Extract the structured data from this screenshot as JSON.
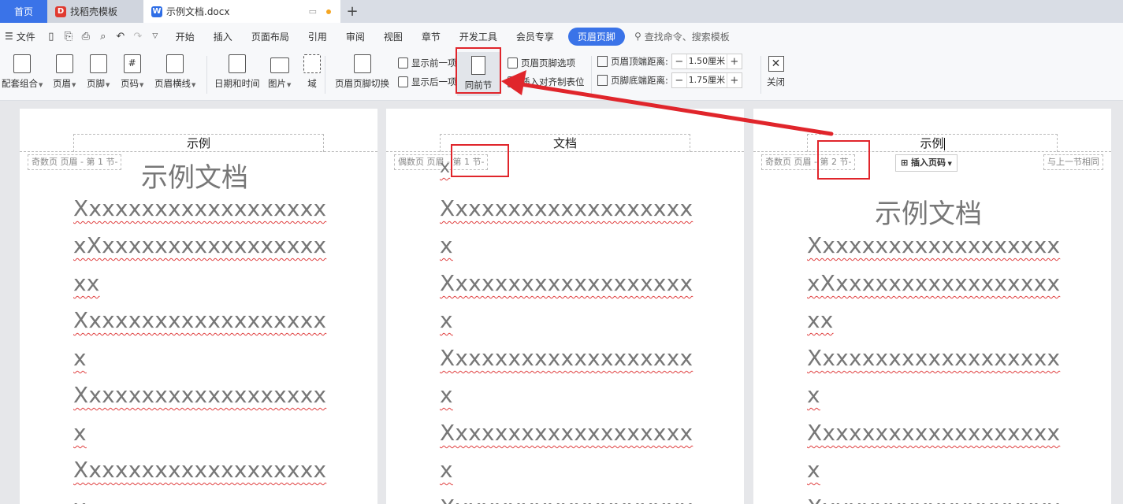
{
  "tabs": {
    "home": "首页",
    "templates": "找稻壳模板",
    "doc": "示例文档.docx"
  },
  "menu": {
    "file": "文件",
    "items": [
      "开始",
      "插入",
      "页面布局",
      "引用",
      "审阅",
      "视图",
      "章节",
      "开发工具",
      "会员专享"
    ],
    "active": "页眉页脚",
    "search": "查找命令、搜索模板"
  },
  "ribbon": {
    "combo": "配套组合",
    "header": "页眉",
    "footer": "页脚",
    "pagenum": "页码",
    "header_line": "页眉横线",
    "datetime": "日期和时间",
    "picture": "图片",
    "field": "域",
    "switch": "页眉页脚切换",
    "show_prev": "显示前一项",
    "show_next": "显示后一项",
    "same_as_prev": "同前节",
    "hf_options": "页眉页脚选项",
    "insert_align_tab": "插入对齐制表位",
    "header_top_label": "页眉顶端距离:",
    "header_top_value": "1.50厘米",
    "footer_bottom_label": "页脚底端距离:",
    "footer_bottom_value": "1.75厘米",
    "close": "关闭"
  },
  "pages": [
    {
      "header_text": "示例",
      "label": "奇数页 页眉 - 第 1 节-",
      "title": "示例文档",
      "lines": [
        "Xxxxxxxxxxxxxxxxxxx",
        "xXxxxxxxxxxxxxxxxxx",
        "xx",
        "Xxxxxxxxxxxxxxxxxxx",
        "x",
        "Xxxxxxxxxxxxxxxxxxx",
        "x",
        "Xxxxxxxxxxxxxxxxxxx",
        "x"
      ]
    },
    {
      "header_text": "文档",
      "label_prefix": "偶数页 页眉",
      "label_sec": "- 第 1 节-",
      "lines": [
        "x",
        "Xxxxxxxxxxxxxxxxxxx",
        "x",
        "Xxxxxxxxxxxxxxxxxxx",
        "x",
        "Xxxxxxxxxxxxxxxxxxx",
        "x",
        "Xxxxxxxxxxxxxxxxxxx",
        "x",
        "Xxxxxxxxxxxxxxxxxxx"
      ]
    },
    {
      "header_text": "示例",
      "label_prefix": "奇数页 页眉",
      "label_sec": "- 第 2 节-",
      "insert_pn": "插入页码",
      "same_prev": "与上一节相同",
      "title": "示例文档",
      "lines": [
        "Xxxxxxxxxxxxxxxxxxx",
        "xXxxxxxxxxxxxxxxxxx",
        "xx",
        "Xxxxxxxxxxxxxxxxxxx",
        "x",
        "Xxxxxxxxxxxxxxxxxxx",
        "x",
        "Xxxxxxxxxxxxxxxxxxx"
      ]
    }
  ],
  "colors": {
    "accent": "#3a73e8",
    "annotation": "#e0252b"
  }
}
